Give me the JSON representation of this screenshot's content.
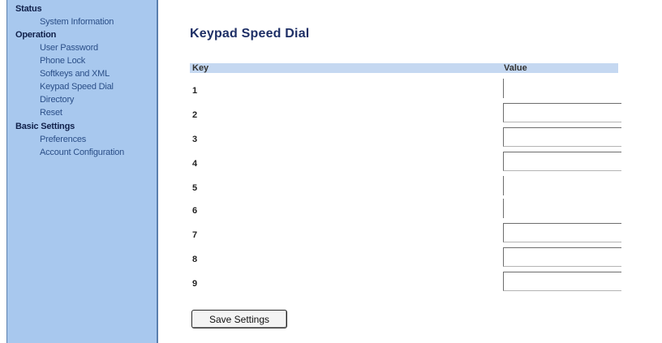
{
  "sidebar": {
    "sections": [
      {
        "label": "Status",
        "items": [
          "System Information"
        ]
      },
      {
        "label": "Operation",
        "items": [
          "User Password",
          "Phone Lock",
          "Softkeys and XML",
          "Keypad Speed Dial",
          "Directory",
          "Reset"
        ]
      },
      {
        "label": "Basic Settings",
        "items": [
          "Preferences",
          "Account Configuration"
        ]
      }
    ]
  },
  "main": {
    "title": "Keypad Speed Dial",
    "table": {
      "headers": {
        "key": "Key",
        "value": "Value"
      },
      "rows": [
        {
          "key": "1",
          "value": "",
          "field": "narrow"
        },
        {
          "key": "2",
          "value": "",
          "field": "box"
        },
        {
          "key": "3",
          "value": "",
          "field": "box"
        },
        {
          "key": "4",
          "value": "",
          "field": "box"
        },
        {
          "key": "5",
          "value": "",
          "field": "narrow"
        },
        {
          "key": "6",
          "value": "",
          "field": "narrow"
        },
        {
          "key": "7",
          "value": "",
          "field": "box"
        },
        {
          "key": "8",
          "value": "",
          "field": "box"
        },
        {
          "key": "9",
          "value": "",
          "field": "box"
        }
      ]
    },
    "save_label": "Save Settings"
  }
}
